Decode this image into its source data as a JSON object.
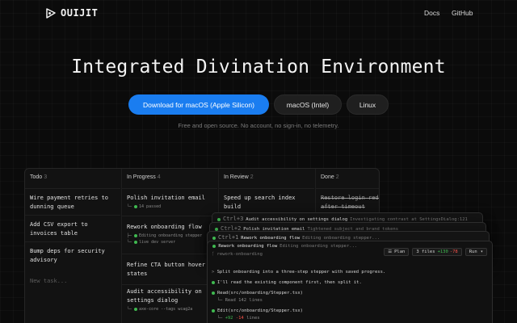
{
  "nav": {
    "brand": "OUIJIT",
    "links": [
      "Docs",
      "GitHub"
    ]
  },
  "hero": {
    "title": "Integrated Divination Environment",
    "buttons": [
      "Download for macOS (Apple Silicon)",
      "macOS (Intel)",
      "Linux"
    ],
    "subtitle": "Free and open source. No account, no sign-in, no telemetry."
  },
  "board": {
    "columns": [
      {
        "name": "Todo",
        "count": "3"
      },
      {
        "name": "In Progress",
        "count": "4"
      },
      {
        "name": "In Review",
        "count": "2"
      },
      {
        "name": "Done",
        "count": "2"
      }
    ],
    "todo": [
      "Wire payment retries to dunning queue",
      "Add CSV export to invoices table",
      "Bump deps for security advisory"
    ],
    "new_task": "New task...",
    "in_progress": [
      {
        "title": "Polish invitation email",
        "meta": "14 passed"
      },
      {
        "title": "Rework onboarding flow",
        "meta1": "Editing onboarding stepper",
        "meta2": "live dev server"
      },
      {
        "title": "Refine CTA button hover states"
      },
      {
        "title": "Audit accessibility on settings dialog",
        "meta": "axe-core --tags wcag2a"
      }
    ],
    "in_review": [
      {
        "title": "Speed up search index build"
      }
    ],
    "done": [
      {
        "title": "Restore login redirect after timeout"
      }
    ]
  },
  "windows": [
    {
      "kbd": "Ctrl+3",
      "title": "Audit accessibility on settings dialog",
      "status": "Investigating contrast at SettingsDialog:121"
    },
    {
      "kbd": "Ctrl+2",
      "title": "Polish invitation email",
      "status": "Tightened subject and brand tokens"
    },
    {
      "kbd": "Ctrl+1",
      "title": "Rework onboarding flow",
      "status": "Editing onboarding stepper..."
    }
  ],
  "terminal": {
    "branch": "rework-onboarding",
    "plan": "Plan",
    "files": "3 files",
    "added": "+130",
    "removed": "-78",
    "run": "Run",
    "lines": {
      "prompt": "Split onboarding into a three-step stepper with saved progress.",
      "reply": "I'll read the existing component first, then split it.",
      "read_cmd": "Read(src/onboarding/Stepper.tsx)",
      "read_result": "Read 142 lines",
      "edit_cmd": "Edit(src/onboarding/Stepper.tsx)",
      "edit_add": "+92",
      "edit_del": "-14",
      "edit_suffix": "lines"
    }
  },
  "colors": {
    "accent": "#1a7df0",
    "success": "#3fb950",
    "danger": "#f85149",
    "background": "#0b0b0b"
  }
}
